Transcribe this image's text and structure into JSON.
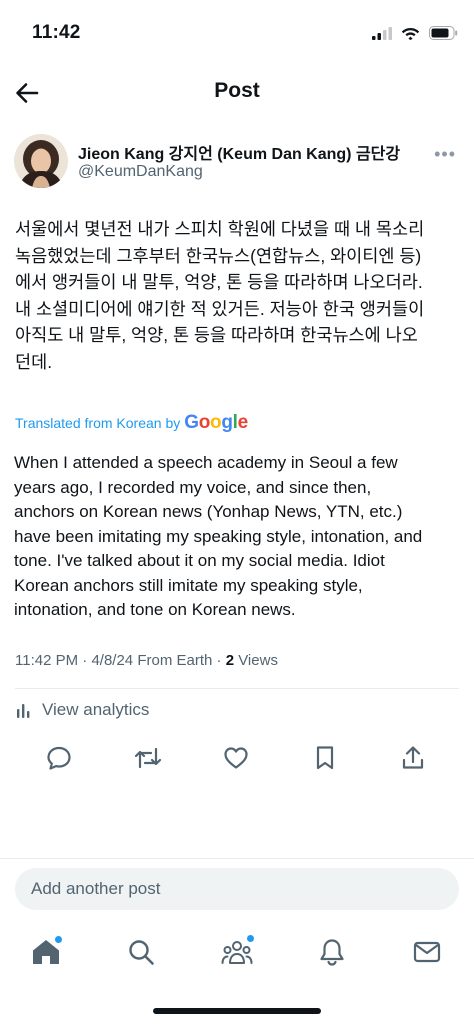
{
  "status_bar": {
    "time": "11:42"
  },
  "header": {
    "title": "Post",
    "back_icon": "arrow-left-icon"
  },
  "author": {
    "name": "Jieon Kang 강지언 (Keum Dan Kang) 금단강",
    "handle": "@KeumDanKang",
    "more_icon": "more-dots-icon",
    "more_glyph": "•••"
  },
  "post": {
    "original_lines": [
      "서울에서 몇년전 내가 스피치 학원에 다녔을 때 내 목소리",
      "녹음했었는데 그후부터 한국뉴스(연합뉴스, 와이티엔 등)",
      "에서 앵커들이 내 말투, 억양, 톤 등을 따라하며 나오더라.",
      "내 소셜미디어에  얘기한 적 있거든. 저능아 한국 앵커들이",
      "아직도 내 말투, 억양, 톤 등을 따라하며 한국뉴스에 나오",
      "던데."
    ],
    "translated_label": "Translated from Korean by",
    "google_logo": "Google",
    "translated_lines": [
      "When I attended a speech academy in Seoul a few",
      "years ago, I recorded my voice, and since then,",
      "anchors on Korean news (Yonhap News, YTN, etc.)",
      "have been imitating my speaking style, intonation, and",
      "tone. I've talked about it on my social media. Idiot",
      "Korean anchors still imitate my speaking style,",
      "intonation, and tone on Korean news."
    ],
    "time": "11:42 PM",
    "date": "4/8/24",
    "source": "From Earth",
    "views_count": "2",
    "views_label": "Views",
    "separator": "·"
  },
  "analytics": {
    "label": "View analytics",
    "icon": "bar-chart-icon"
  },
  "actions": [
    {
      "name": "reply",
      "icon": "reply-icon"
    },
    {
      "name": "repost",
      "icon": "repost-icon"
    },
    {
      "name": "like",
      "icon": "heart-icon"
    },
    {
      "name": "bookmark",
      "icon": "bookmark-icon"
    },
    {
      "name": "share",
      "icon": "share-icon"
    }
  ],
  "composer": {
    "placeholder": "Add another post"
  },
  "tab_bar": [
    {
      "name": "home",
      "icon": "home-icon",
      "has_dot": true
    },
    {
      "name": "search",
      "icon": "search-icon",
      "has_dot": false
    },
    {
      "name": "communities",
      "icon": "communities-icon",
      "has_dot": true
    },
    {
      "name": "notifications",
      "icon": "bell-icon",
      "has_dot": false
    },
    {
      "name": "messages",
      "icon": "mail-icon",
      "has_dot": false
    }
  ],
  "colors": {
    "accent": "#1d9bf0",
    "text_primary": "#0f1419",
    "text_secondary": "#536471",
    "composer_bg": "#eff3f4"
  }
}
